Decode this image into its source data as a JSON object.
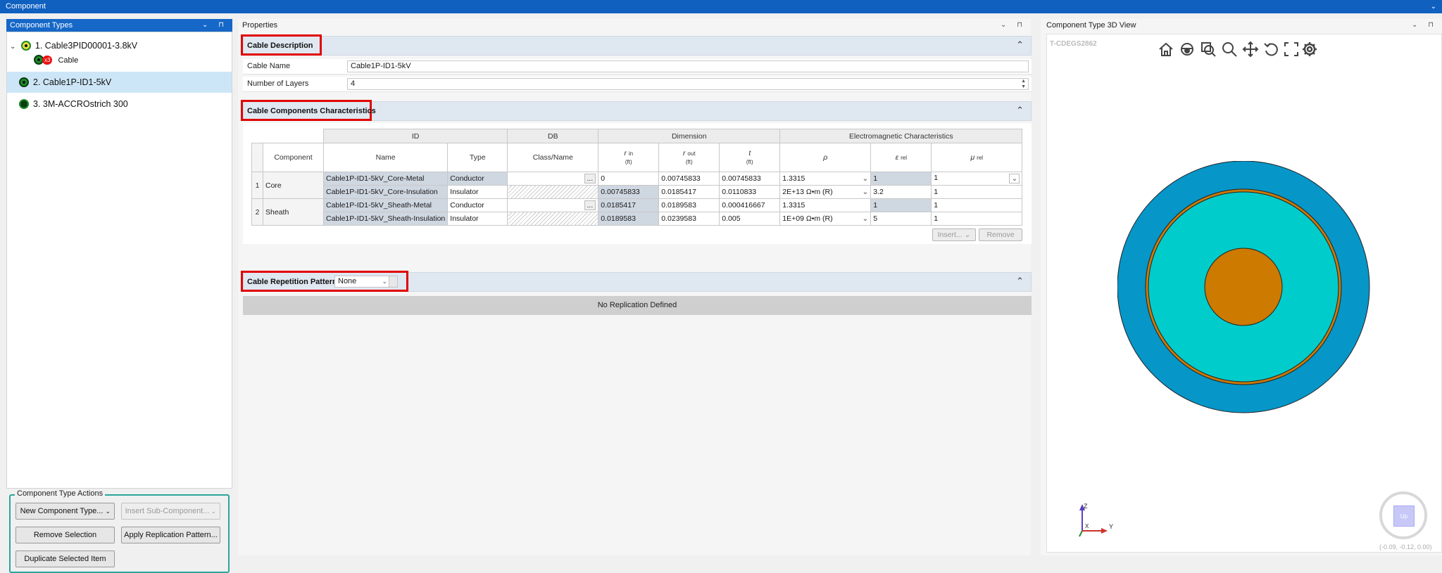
{
  "window": {
    "title": "Component",
    "controls": "⌄"
  },
  "component_types": {
    "header": "Component Types",
    "controls": "⌄ ⊓",
    "tree": [
      {
        "label": "1. Cable3PID00001-3.8kV",
        "expand": "⌄"
      },
      {
        "label": "Cable",
        "badge": "x3"
      },
      {
        "label": "2. Cable1P-ID1-5kV"
      },
      {
        "label": "3. 3M-ACCROstrich 300"
      }
    ]
  },
  "actions": {
    "title": "Component Type Actions",
    "new_component": "New Component Type...",
    "insert_sub": "Insert Sub-Component...",
    "remove_selection": "Remove Selection",
    "apply_replication": "Apply Replication Pattern...",
    "duplicate": "Duplicate Selected Item"
  },
  "properties": {
    "header": "Properties",
    "controls": "⌄ ⊓",
    "cable_description": {
      "title": "Cable Description",
      "name_label": "Cable Name",
      "name_value": "Cable1P-ID1-5kV",
      "layers_label": "Number of Layers",
      "layers_value": "4"
    },
    "cable_components": {
      "title": "Cable Components Characteristics",
      "groups": [
        "ID",
        "DB",
        "Dimension",
        "Electromagnetic Characteristics"
      ],
      "headers": {
        "component": "Component",
        "name": "Name",
        "type": "Type",
        "class_name": "Class/Name",
        "r_in": "r",
        "r_in_sub": "in",
        "r_out": "r",
        "r_out_sub": "out",
        "t": "t",
        "unit": "(ft)",
        "rho": "ρ",
        "eps": "ε",
        "eps_sub": "rel",
        "mu": "μ",
        "mu_sub": "rel"
      },
      "components": [
        {
          "num": "1",
          "name": "Core"
        },
        {
          "num": "2",
          "name": "Sheath"
        }
      ],
      "rows": [
        {
          "name": "Cable1P-ID1-5kV_Core-Metal",
          "type": "Conductor",
          "class_btn": "...",
          "r_in": "0",
          "r_out": "0.00745833",
          "t": "0.00745833",
          "rho": "1.3315",
          "eps": "1",
          "mu": "1"
        },
        {
          "name": "Cable1P-ID1-5kV_Core-Insulation",
          "type": "Insulator",
          "class_btn": "",
          "r_in": "0.00745833",
          "r_out": "0.0185417",
          "t": "0.0110833",
          "rho": "2E+13 Ω•m (R)",
          "eps": "3.2",
          "mu": "1"
        },
        {
          "name": "Cable1P-ID1-5kV_Sheath-Metal",
          "type": "Conductor",
          "class_btn": "...",
          "r_in": "0.0185417",
          "r_out": "0.0189583",
          "t": "0.000416667",
          "rho": "1.3315",
          "eps": "1",
          "mu": "1"
        },
        {
          "name": "Cable1P-ID1-5kV_Sheath-Insulation",
          "type": "Insulator",
          "class_btn": "",
          "r_in": "0.0189583",
          "r_out": "0.0239583",
          "t": "0.005",
          "rho": "1E+09 Ω•m (R)",
          "eps": "5",
          "mu": "1"
        }
      ],
      "insert_btn": "Insert...",
      "remove_btn": "Remove"
    },
    "repetition": {
      "title": "Cable Repetition Pattern",
      "value": "None",
      "empty_text": "No Replication Defined"
    }
  },
  "view3d": {
    "header": "Component Type 3D View",
    "controls": "⌄ ⊓",
    "id_label": "T-CDEGS2862",
    "tools": [
      "home-icon",
      "view-icon",
      "zoom-fit-icon",
      "zoom-icon",
      "pan-icon",
      "rotate-icon",
      "fullscreen-icon",
      "settings-icon"
    ],
    "axes": {
      "z": "Z",
      "x": "X",
      "y": "Y"
    },
    "coords": "(-0.09, -0.12, 0.00)",
    "nav_cube": "Up",
    "colors": {
      "outer": "#0696c8",
      "cyan": "#00cccc",
      "sheath": "#c87a0a",
      "core": "#cc7a00"
    }
  }
}
